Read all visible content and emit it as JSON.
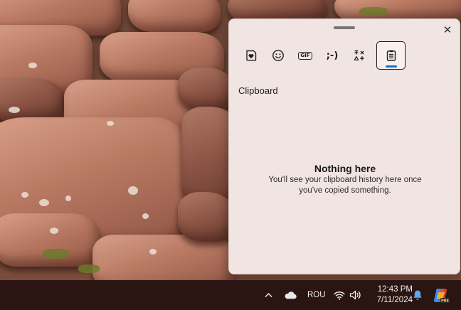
{
  "panel": {
    "close_glyph": "✕",
    "tabs": [
      {
        "name": "sticker-tab",
        "icon": "heart-sticker-icon"
      },
      {
        "name": "emoji-tab",
        "icon": "smiley-icon"
      },
      {
        "name": "gif-tab",
        "icon": "gif-icon",
        "label": "GIF"
      },
      {
        "name": "kaomoji-tab",
        "icon": "kaomoji-icon",
        "label": ";-)"
      },
      {
        "name": "symbols-tab",
        "icon": "symbols-icon"
      },
      {
        "name": "clipboard-tab",
        "icon": "clipboard-icon",
        "active": true
      }
    ],
    "section_title": "Clipboard",
    "empty_title": "Nothing here",
    "empty_description": "You'll see your clipboard history here once you've copied something."
  },
  "taskbar": {
    "chevron_glyph": "^",
    "language": "ROU",
    "time": "12:43 PM",
    "date": "7/11/2024",
    "icons": [
      "show-hidden-icons-chevron",
      "onedrive-cloud-icon",
      "wifi-icon",
      "volume-icon",
      "notification-bell-icon",
      "copilot-icon"
    ]
  },
  "colors": {
    "panel_bg": "#f1e5e3",
    "taskbar_bg": "#2a1512",
    "accent": "#1b6fc6"
  }
}
